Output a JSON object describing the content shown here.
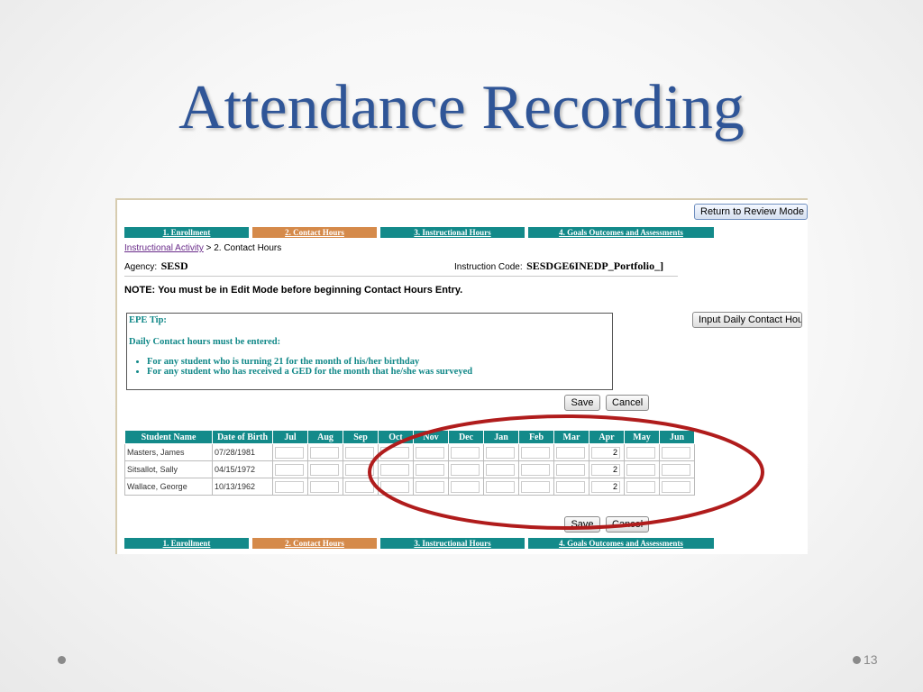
{
  "slide": {
    "title": "Attendance Recording",
    "page_number": "13"
  },
  "toolbar": {
    "return_label": "Return to Review Mode",
    "input_daily_label": "Input Daily Contact Hour"
  },
  "tabs": [
    {
      "label": "1. Enrollment",
      "active": false
    },
    {
      "label": "2. Contact Hours",
      "active": true
    },
    {
      "label": "3. Instructional Hours",
      "active": false
    },
    {
      "label": "4. Goals Outcomes and Assessments",
      "active": false
    }
  ],
  "breadcrumb": {
    "link": "Instructional Activity",
    "separator": ">",
    "current": "2. Contact Hours"
  },
  "agency": {
    "label": "Agency:",
    "value": "SESD"
  },
  "instruction_code": {
    "label": "Instruction Code:",
    "value": "SESDGE6INEDP_Portfolio_]"
  },
  "note": "NOTE: You must be in Edit Mode before beginning Contact Hours Entry.",
  "tip": {
    "heading": "EPE Tip:",
    "subheading": "Daily Contact hours must be entered:",
    "bullets": [
      "For any student who is turning 21 for the month of his/her birthday",
      "For any student who has received a GED for the month that he/she was surveyed"
    ]
  },
  "actions": {
    "save_label": "Save",
    "cancel_label": "Cancel"
  },
  "table": {
    "columns": [
      "Student Name",
      "Date of Birth",
      "Jul",
      "Aug",
      "Sep",
      "Oct",
      "Nov",
      "Dec",
      "Jan",
      "Feb",
      "Mar",
      "Apr",
      "May",
      "Jun"
    ],
    "rows": [
      {
        "name": "Masters, James",
        "dob": "07/28/1981",
        "hours": [
          "",
          "",
          "",
          "",
          "",
          "",
          "",
          "",
          "",
          "2",
          "",
          ""
        ]
      },
      {
        "name": "Sitsallot, Sally",
        "dob": "04/15/1972",
        "hours": [
          "",
          "",
          "",
          "",
          "",
          "",
          "",
          "",
          "",
          "2",
          "",
          ""
        ]
      },
      {
        "name": "Wallace, George",
        "dob": "10/13/1962",
        "hours": [
          "",
          "",
          "",
          "",
          "",
          "",
          "",
          "",
          "",
          "2",
          "",
          ""
        ]
      }
    ]
  },
  "colors": {
    "title": "#2f5597",
    "tab_teal": "#138a8a",
    "tab_active_orange": "#d58a4a",
    "highlight_ellipse": "#b01c1c"
  }
}
